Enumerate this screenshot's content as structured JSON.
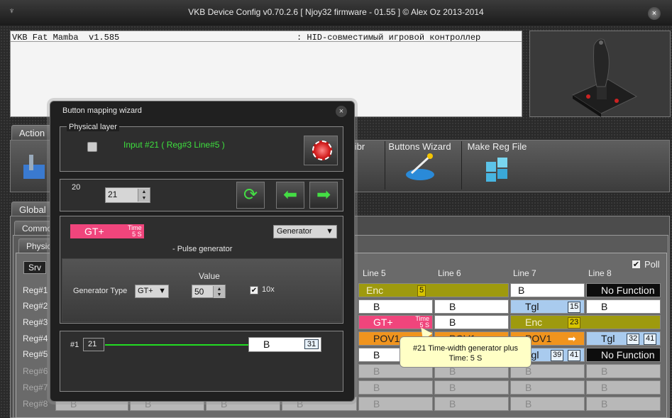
{
  "window": {
    "title": "VKB Device Config v0.70.2.6 [ Njoy32 firmware - 01.55 ] © Alex Oz 2013-2014",
    "close_label": "×"
  },
  "console": {
    "left": "VKB Fat Mamba  v1.585",
    "right": ": HID-совместимый игровой контроллер"
  },
  "tabs": {
    "actions": "Action",
    "global": "Global",
    "common": "Commo",
    "physical": "Physic"
  },
  "toolbar": {
    "calibr": "libr",
    "buttons_wizard": "Buttons Wizard",
    "make_reg_file": "Make Reg File"
  },
  "grid": {
    "srv": "Srv",
    "poll": "Poll",
    "columns": [
      "Line 5",
      "Line 6",
      "Line 7",
      "Line 8"
    ],
    "rows": [
      "Reg#1",
      "Reg#2",
      "Reg#3",
      "Reg#4",
      "Reg#5",
      "Reg#6",
      "Reg#7",
      "Reg#8"
    ],
    "cells": {
      "r1c5": "Enc",
      "r1c5n": "5",
      "r1c7": "B",
      "r1c8": "No Function",
      "r2c5": "B",
      "r2c6": "B",
      "r2c7": "Tgl",
      "r2c7n": "15",
      "r2c8": "B",
      "r3c5": "GT+",
      "r3c6": "B",
      "r3c7": "Enc",
      "r3c7n": "23",
      "r4c5": "POV1",
      "r4c6": "POV1",
      "r4c7": "POV1",
      "r4c8": "Tgl",
      "r4c8n1": "32",
      "r4c8n2": "41",
      "r5c5": "B",
      "r5c7": "Tgl",
      "r5c7n1": "39",
      "r5c7n2": "41",
      "r5c8": "No Function",
      "grey_b": "B",
      "time_label": "Time",
      "time_value": "5 S"
    }
  },
  "tooltip": {
    "line1": "#21   Time-width generator plus",
    "line2": "Time: 5 S"
  },
  "wizard": {
    "title": "Button mapping wizard",
    "close": "×",
    "physical_layer": "Physical layer",
    "input_info": "Input #21  ( Reg#3   Line#5 )",
    "number_label": "20",
    "number_value": "21",
    "func_chip": "GT+",
    "func_time_label": "Time",
    "func_time_value": "5 S",
    "func_select": "Generator",
    "func_desc": "- Pulse generator",
    "value_label": "Value",
    "gentype_label": "Generator Type",
    "gentype_value": "GT+",
    "value": "50",
    "tenx_label": "10x",
    "map_index": "#1",
    "map_num": "21",
    "map_cell": "B",
    "map_cell_num": "31"
  },
  "colors": {
    "gt_plus": "#f0457c",
    "encoder": "#9e9a0e",
    "toggle": "#a9cbee",
    "pov": "#f0941e",
    "status_green": "#3ee03e"
  }
}
